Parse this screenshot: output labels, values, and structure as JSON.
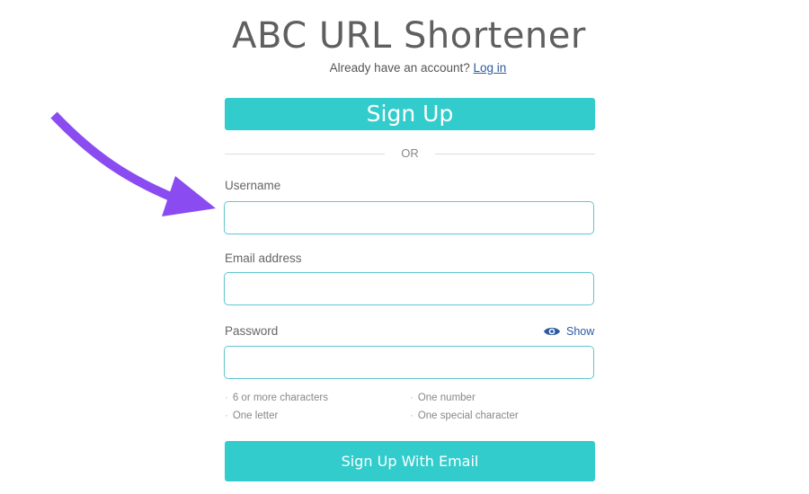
{
  "header": {
    "title": "ABC URL Shortener",
    "login_prompt": "Already have an account?",
    "login_link": "Log in"
  },
  "signup_button": {
    "label": "Sign Up"
  },
  "divider": {
    "label": "OR"
  },
  "form": {
    "username": {
      "label": "Username",
      "value": "",
      "placeholder": ""
    },
    "email": {
      "label": "Email address",
      "value": "",
      "placeholder": ""
    },
    "password": {
      "label": "Password",
      "value": "",
      "placeholder": "",
      "show_toggle": {
        "icon": "eye-icon",
        "label": "Show"
      }
    },
    "requirements": [
      "6 or more characters",
      "One number",
      "One letter",
      "One special character"
    ],
    "submit": {
      "label": "Sign Up With Email"
    }
  },
  "annotation": {
    "icon": "arrow-icon",
    "color": "#8a4bf0"
  },
  "colors": {
    "accent": "#33cccc",
    "link": "#2c5aa0",
    "input_border": "#5fc6d0"
  }
}
